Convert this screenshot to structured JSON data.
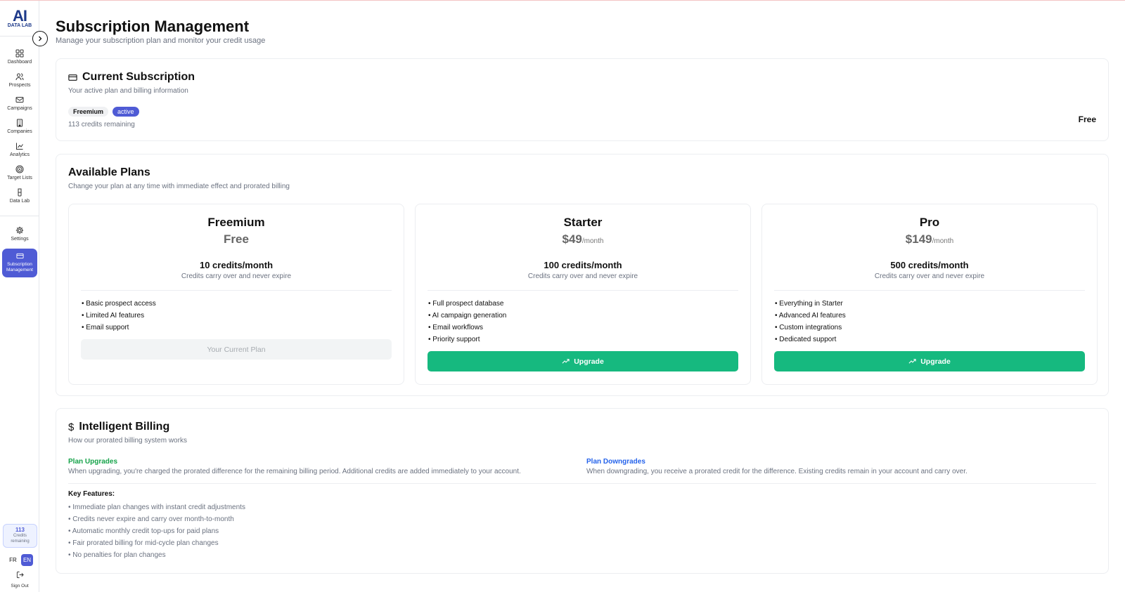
{
  "sidebar": {
    "logo_main": "AI",
    "logo_sub": "DATA LAB",
    "items": [
      {
        "label": "Dashboard",
        "icon": "grid-icon"
      },
      {
        "label": "Prospects",
        "icon": "users-icon"
      },
      {
        "label": "Campaigns",
        "icon": "mail-icon"
      },
      {
        "label": "Companies",
        "icon": "building-icon"
      },
      {
        "label": "Analytics",
        "icon": "chart-line-icon"
      },
      {
        "label": "Target Lists",
        "icon": "target-icon"
      },
      {
        "label": "Data Lab",
        "icon": "flask-icon"
      },
      {
        "label": "Settings",
        "icon": "gear-icon"
      }
    ],
    "active_item": {
      "label_line1": "Subscription",
      "label_line2": "Management",
      "icon": "credit-card-icon"
    },
    "credits": {
      "number": "113",
      "line1": "Credits",
      "line2": "remaining"
    },
    "languages": {
      "fr": "FR",
      "en": "EN",
      "selected": "EN"
    },
    "sign_out": "Sign Out"
  },
  "header": {
    "title": "Subscription Management",
    "subtitle": "Manage your subscription plan and monitor your credit usage"
  },
  "current_subscription": {
    "title": "Current Subscription",
    "subtitle": "Your active plan and billing information",
    "plan_badge": "Freemium",
    "status_badge": "active",
    "credits_remaining": "113 credits remaining",
    "price": "Free"
  },
  "available_plans": {
    "title": "Available Plans",
    "subtitle": "Change your plan at any time with immediate effect and prorated billing",
    "plans": [
      {
        "name": "Freemium",
        "price": "Free",
        "period": "",
        "credits": "10 credits/month",
        "carry": "Credits carry over and never expire",
        "features": [
          "• Basic prospect access",
          "• Limited AI features",
          "• Email support"
        ],
        "button": "Your Current Plan"
      },
      {
        "name": "Starter",
        "price": "$49",
        "period": "/month",
        "credits": "100 credits/month",
        "carry": "Credits carry over and never expire",
        "features": [
          "• Full prospect database",
          "• AI campaign generation",
          "• Email workflows",
          "• Priority support"
        ],
        "button": "Upgrade"
      },
      {
        "name": "Pro",
        "price": "$149",
        "period": "/month",
        "credits": "500 credits/month",
        "carry": "Credits carry over and never expire",
        "features": [
          "• Everything in Starter",
          "• Advanced AI features",
          "• Custom integrations",
          "• Dedicated support"
        ],
        "button": "Upgrade"
      }
    ]
  },
  "billing": {
    "title": "Intelligent Billing",
    "subtitle": "How our prorated billing system works",
    "upgrades_title": "Plan Upgrades",
    "upgrades_text": "When upgrading, you're charged the prorated difference for the remaining billing period. Additional credits are added immediately to your account.",
    "downgrades_title": "Plan Downgrades",
    "downgrades_text": "When downgrading, you receive a prorated credit for the difference. Existing credits remain in your account and carry over.",
    "key_features_title": "Key Features:",
    "key_features": [
      "• Immediate plan changes with instant credit adjustments",
      "• Credits never expire and carry over month-to-month",
      "• Automatic monthly credit top-ups for paid plans",
      "• Fair prorated billing for mid-cycle plan changes",
      "• No penalties for plan changes"
    ]
  },
  "colors": {
    "accent": "#4f5bd5",
    "upgrade_green": "#16b97f",
    "upgrades_title": "#16a34a",
    "downgrades_title": "#2563eb"
  }
}
